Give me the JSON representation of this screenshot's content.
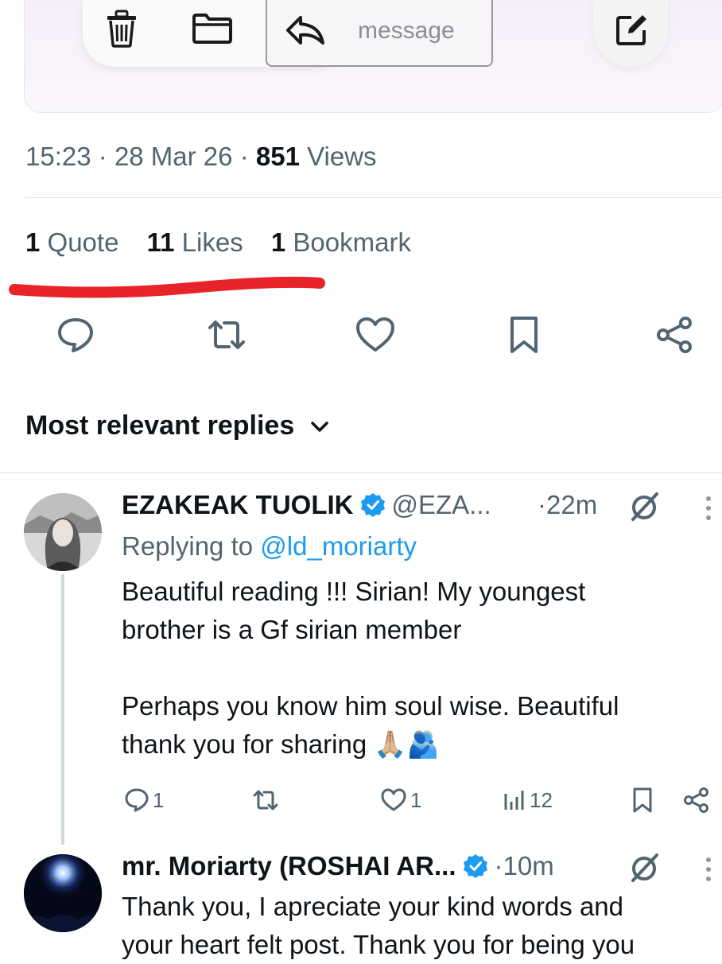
{
  "toolbar": {
    "message_placeholder": "message",
    "icons": [
      "trash-icon",
      "folder-icon",
      "reply-icon",
      "compose-icon"
    ]
  },
  "post_meta": {
    "time": "15:23",
    "sep1": "·",
    "date": "28 Mar 26",
    "sep2": "·",
    "views_count": "851",
    "views_label": "Views"
  },
  "stats": {
    "quotes_count": "1",
    "quotes_label": "Quote",
    "likes_count": "11",
    "likes_label": "Likes",
    "bookmarks_count": "1",
    "bookmarks_label": "Bookmark"
  },
  "actions": [
    "reply-icon",
    "repost-icon",
    "like-icon",
    "bookmark-icon",
    "share-icon"
  ],
  "replies_header": {
    "label": "Most relevant replies"
  },
  "replies": [
    {
      "name": "EZAKEAK TUOLIK",
      "handle": "@EZA...",
      "time": "·22m",
      "replying_prefix": "Replying to",
      "replying_to": "@ld_moriarty",
      "body_line1": "Beautiful reading !!! Sirian! My youngest",
      "body_line2": "brother is a Gf sirian member",
      "body_line3": "Perhaps you know him soul wise. Beautiful",
      "body_line4": "thank you for sharing",
      "emoji": "🙏🏼🫂",
      "replies_count": "1",
      "likes_count": "1",
      "views_count": "12"
    },
    {
      "name": "mr. Moriarty (ROSHAI AR...",
      "time": "·10m",
      "body_line1": "Thank you, I apreciate your kind words and",
      "body_line2": "your heart felt post. Thank you for being you"
    }
  ],
  "colors": {
    "accent": "#1d9bf0",
    "verified": "#1d9bf0",
    "annotation_underline": "#e8242b",
    "secondary_text": "#536471"
  }
}
